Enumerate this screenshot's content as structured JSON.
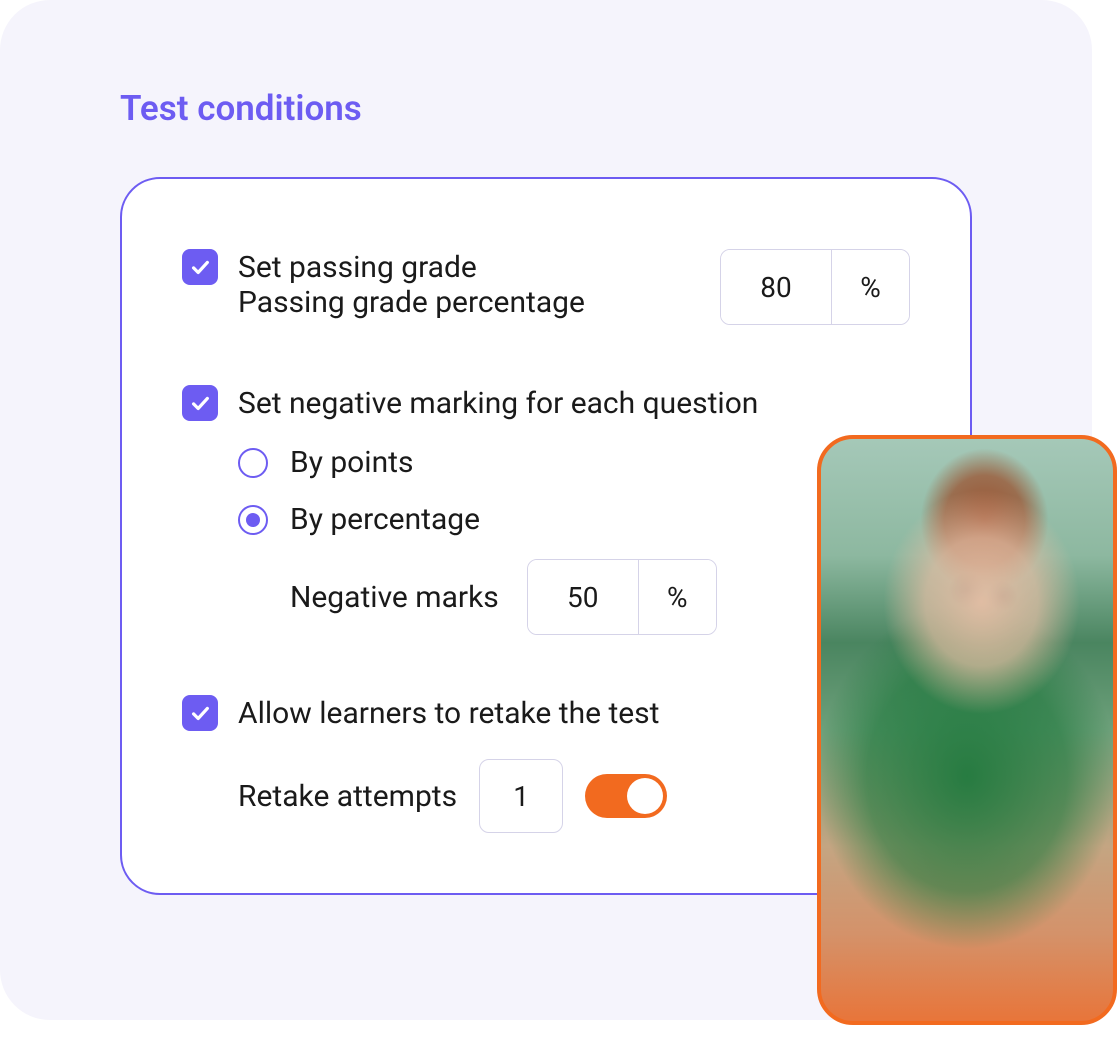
{
  "section": {
    "title": "Test conditions"
  },
  "passing_grade": {
    "checkbox_label": "Set passing grade",
    "sublabel": "Passing grade percentage",
    "value": "80",
    "unit": "%"
  },
  "negative_marking": {
    "checkbox_label": "Set negative marking for each question",
    "option_points": "By points",
    "option_percentage": "By percentage",
    "selected": "percentage",
    "nested_label": "Negative marks",
    "value": "50",
    "unit": "%"
  },
  "retake": {
    "checkbox_label": "Allow learners to retake the test",
    "attempts_label": "Retake attempts",
    "attempts_value": "1",
    "toggle_on": true
  },
  "colors": {
    "accent": "#6d5cf2",
    "toggle": "#f26a1f"
  }
}
